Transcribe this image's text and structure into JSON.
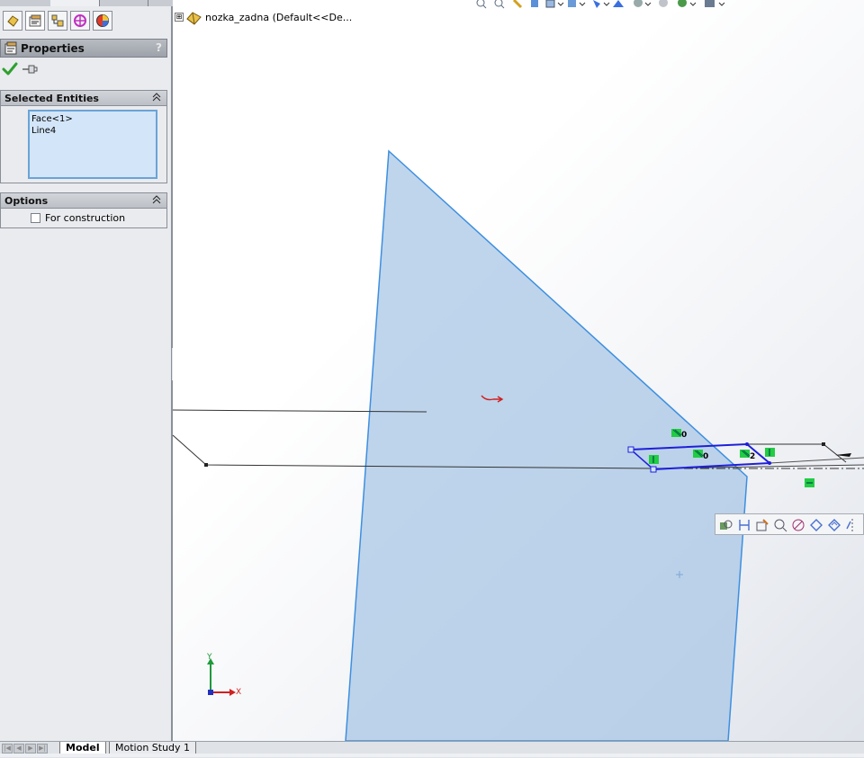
{
  "feature_manager": {
    "tabs": [
      {
        "icon": "part-icon"
      },
      {
        "icon": "property-icon"
      },
      {
        "icon": "configuration-icon"
      },
      {
        "icon": "dimxpert-icon"
      },
      {
        "icon": "display-manager-icon"
      }
    ]
  },
  "property_manager": {
    "title": "Properties",
    "help_label": "?",
    "ok_icon": "checkmark-icon",
    "pin_icon": "pushpin-icon",
    "selected_entities": {
      "title": "Selected Entities",
      "collapse_glyph": "»",
      "items": [
        "Face<1>",
        "Line4"
      ]
    },
    "options": {
      "title": "Options",
      "collapse_glyph": "»",
      "for_construction_label": "For construction",
      "for_construction_checked": false
    }
  },
  "feature_tree": {
    "expander": "⊞",
    "root_label": "nozka_zadna  (Default<<De..."
  },
  "triad": {
    "y_label": "Y",
    "x_label": "X"
  },
  "relation_labels": [
    "0",
    "0",
    "2"
  ],
  "bottom_tabs": [
    {
      "label": "Model",
      "active": true
    },
    {
      "label": "Motion Study 1",
      "active": false
    }
  ],
  "colors": {
    "face_fill": "#a9c7e6",
    "face_edge": "#3d8fe0",
    "sketch_blue": "#1f1fd8",
    "relation_green": "#22cc44",
    "panel_bg": "#e9ebee"
  }
}
